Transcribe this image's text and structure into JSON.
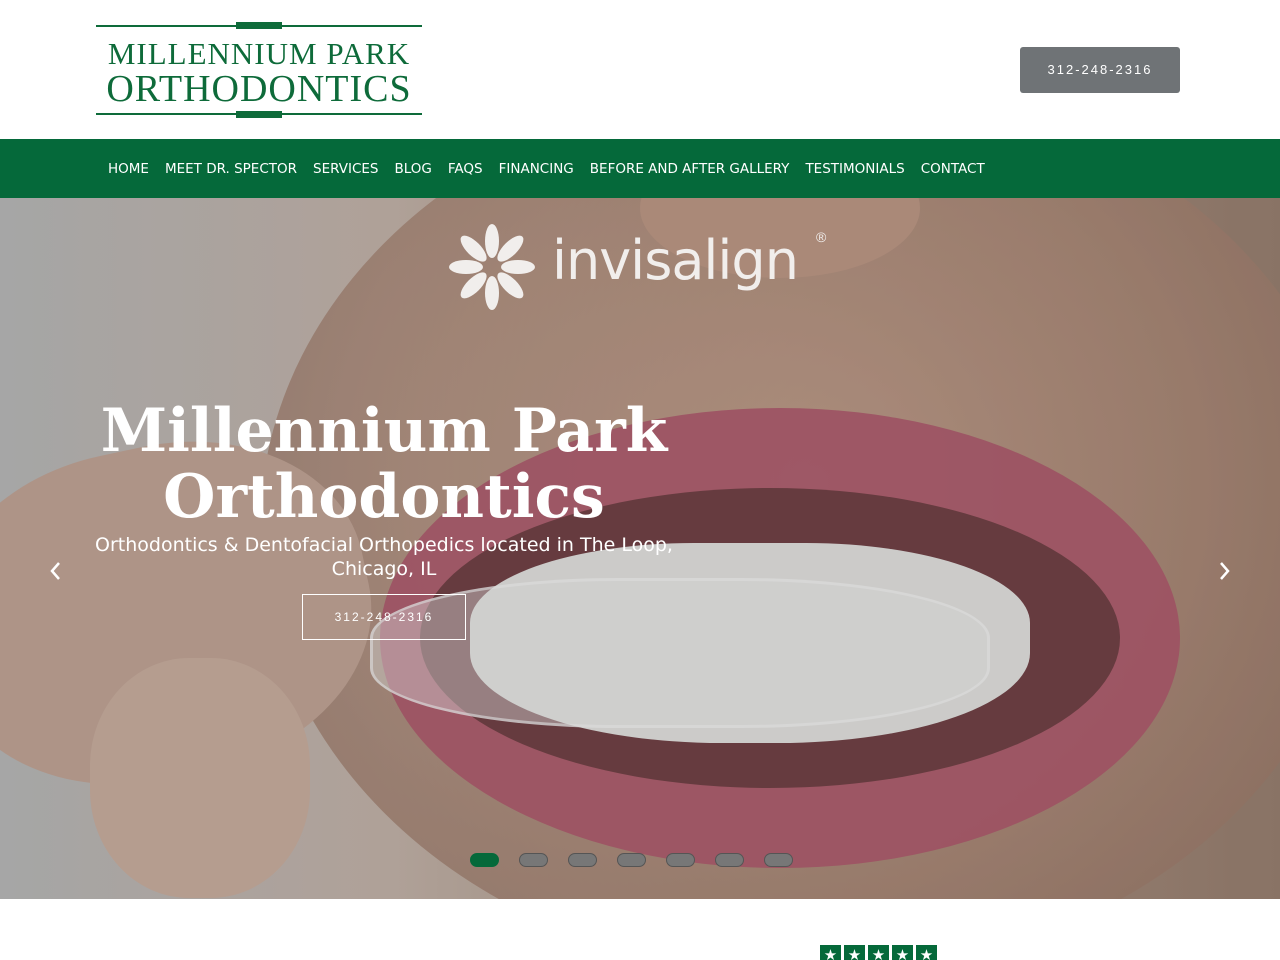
{
  "header": {
    "logo_line1": "MILLENNIUM PARK",
    "logo_line2": "ORTHODONTICS",
    "phone_button": "312-248-2316"
  },
  "nav": {
    "items": [
      {
        "label": "HOME"
      },
      {
        "label": "MEET DR. SPECTOR"
      },
      {
        "label": "SERVICES"
      },
      {
        "label": "BLOG"
      },
      {
        "label": "FAQS"
      },
      {
        "label": "FINANCING"
      },
      {
        "label": "BEFORE AND AFTER GALLERY"
      },
      {
        "label": "TESTIMONIALS"
      },
      {
        "label": "CONTACT"
      }
    ]
  },
  "hero": {
    "brand_logo_text": "invisalign",
    "brand_registered": "®",
    "title_line1": "Millennium Park",
    "title_line2": "Orthodontics",
    "subtitle_line1": "Orthodontics & Dentofacial Orthopedics located in The Loop,",
    "subtitle_line2": "Chicago, IL",
    "phone_button": "312-248-2316",
    "prev_icon": "chevron-left-icon",
    "next_icon": "chevron-right-icon",
    "slide_count": 7,
    "active_slide": 1
  },
  "reviews": {
    "stars": 5,
    "star_icon": "star-icon"
  },
  "colors": {
    "brand_green": "#05693a",
    "logo_green": "#0e6b3a",
    "phone_button_gray": "#6f7376"
  }
}
